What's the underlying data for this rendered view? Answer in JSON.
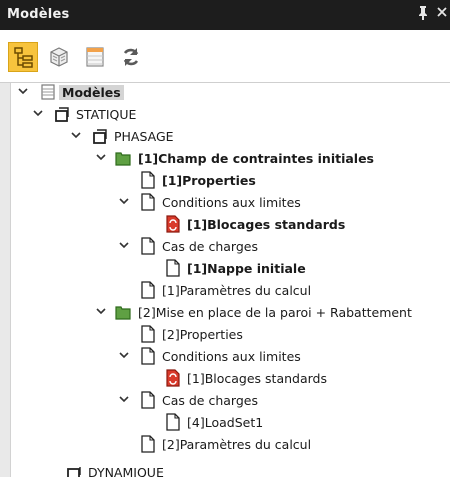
{
  "window": {
    "title": "Modèles",
    "pin_glyph": "ᵖ",
    "close_glyph": "×"
  },
  "toolbar": {
    "buttons": [
      {
        "icon": "tree-view-icon",
        "active": true
      },
      {
        "icon": "model-3d-icon",
        "active": false
      },
      {
        "icon": "table-icon",
        "active": false
      },
      {
        "icon": "refresh-icon",
        "active": false
      }
    ]
  },
  "tree": {
    "root": "Modèles",
    "statique": "STATIQUE",
    "phasage": "PHASAGE",
    "phase1": {
      "label": "[1]Champ de contraintes initiales",
      "properties": "[1]Properties",
      "conditions": "Conditions aux limites",
      "blocages": "[1]Blocages standards",
      "cas": "Cas de charges",
      "nappe": "[1]Nappe initiale",
      "params": "[1]Paramètres du calcul"
    },
    "phase2": {
      "label": "[2]Mise en place de la paroi + Rabattement",
      "properties": "[2]Properties",
      "conditions": "Conditions aux limites",
      "blocages": "[1]Blocages standards",
      "cas": "Cas de charges",
      "loadset": "[4]LoadSet1",
      "params": "[2]Paramètres du calcul"
    },
    "dynamique": "DYNAMIQUE"
  }
}
